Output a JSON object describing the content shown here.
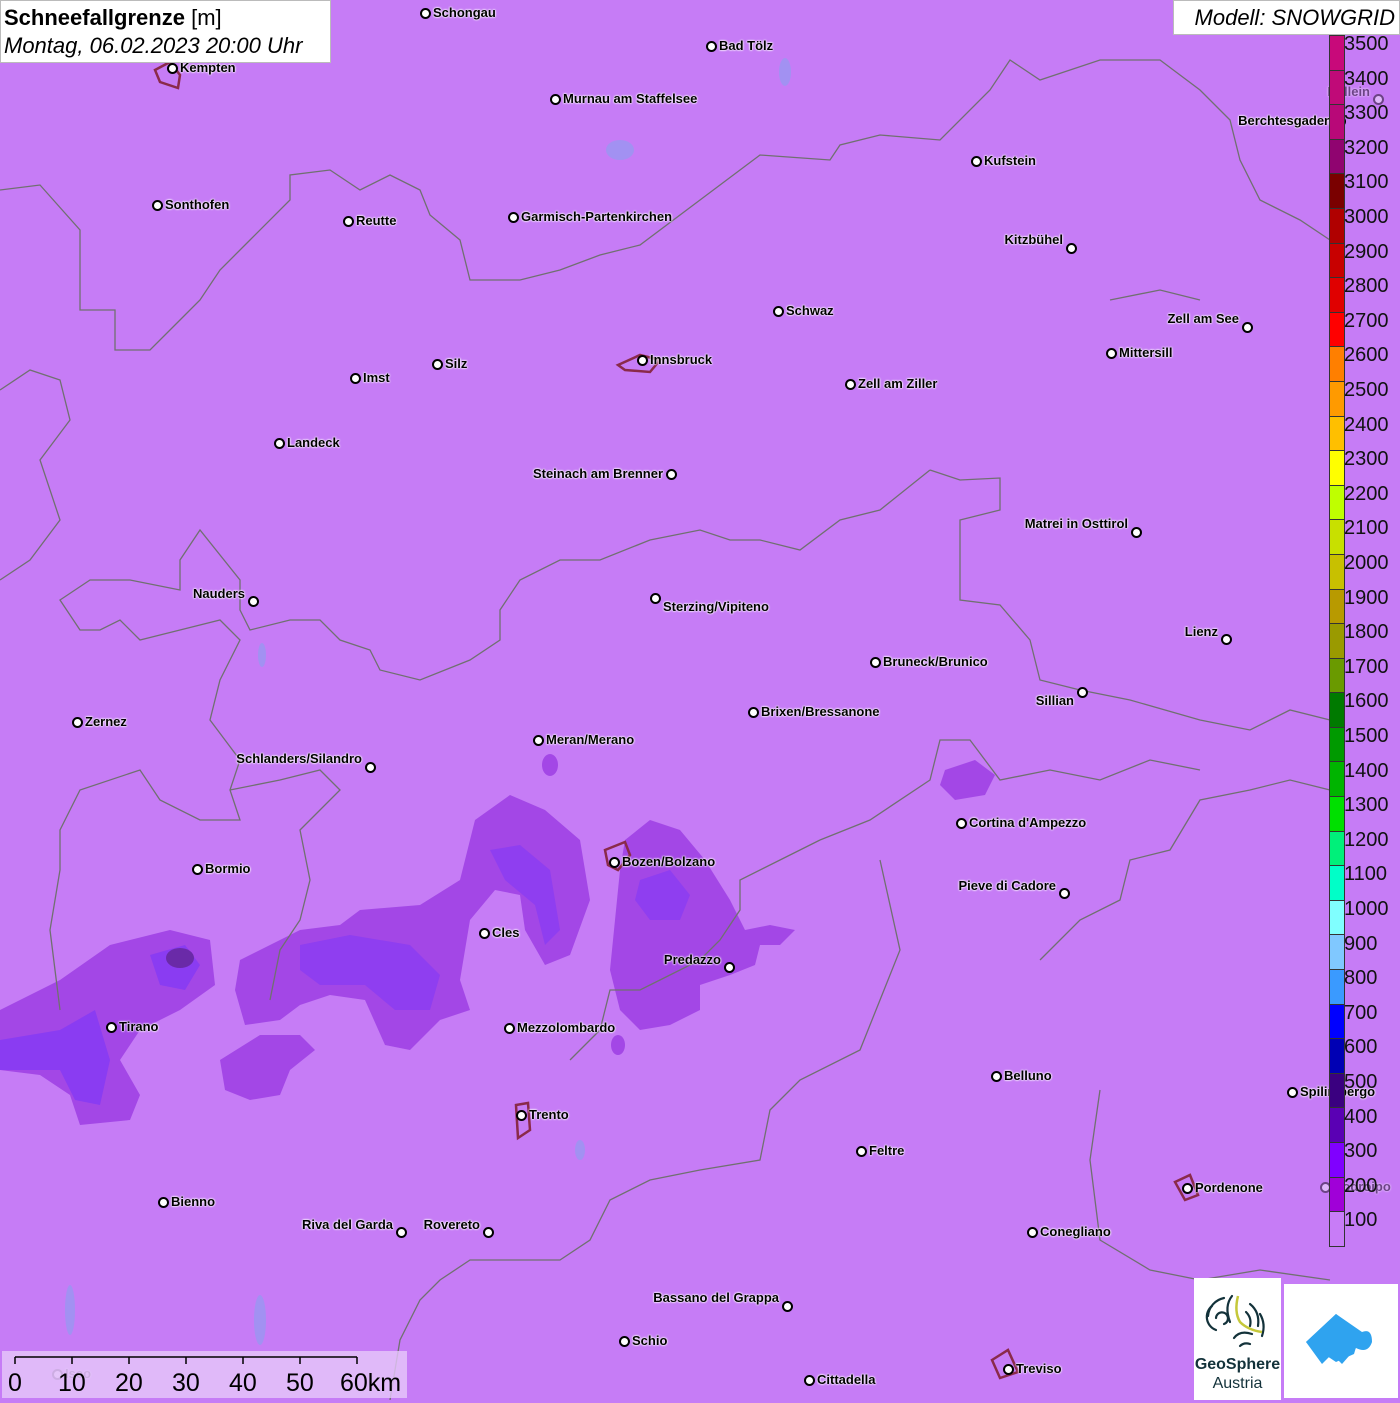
{
  "header": {
    "title_bold": "Schneefallgrenze",
    "title_unit": "[m]",
    "datetime": "Montag, 06.02.2023 20:00 Uhr",
    "model": "Modell: SNOWGRID"
  },
  "legend": {
    "labels": [
      "3500",
      "3400",
      "3300",
      "3200",
      "3100",
      "3000",
      "2900",
      "2800",
      "2700",
      "2600",
      "2500",
      "2400",
      "2300",
      "2200",
      "2100",
      "2000",
      "1900",
      "1800",
      "1700",
      "1600",
      "1500",
      "1400",
      "1300",
      "1200",
      "1100",
      "1000",
      "900",
      "800",
      "700",
      "600",
      "500",
      "400",
      "300",
      "200",
      "100"
    ],
    "colors": [
      "#c8097a",
      "#c00a78",
      "#b80878",
      "#900470",
      "#7a0000",
      "#b00000",
      "#c80000",
      "#e00000",
      "#ff0000",
      "#ff7f00",
      "#ff9a00",
      "#ffbf00",
      "#ffff00",
      "#bfff00",
      "#c8e000",
      "#c8c000",
      "#b89a00",
      "#9a9a00",
      "#6a9a00",
      "#007a00",
      "#009a00",
      "#00b400",
      "#00e000",
      "#00f07a",
      "#00ffc8",
      "#80ffff",
      "#80c8ff",
      "#3a9aff",
      "#0000ff",
      "#0000b4",
      "#3a0080",
      "#5a00b4",
      "#8000ff",
      "#a000d8",
      "#c87cf7"
    ]
  },
  "cities": [
    "Schongau",
    "Bad Tölz",
    "Kempten",
    "Murnau am Staffelsee",
    "Hallein",
    "Berchtesgaden",
    "Kufstein",
    "Sonthofen",
    "Reutte",
    "Garmisch-Partenkirchen",
    "Kitzbühel",
    "Schwaz",
    "Zell am See",
    "Innsbruck",
    "Mittersill",
    "Silz",
    "Imst",
    "Zell am Ziller",
    "Landeck",
    "Steinach am Brenner",
    "Matrei in Osttirol",
    "Nauders",
    "Sterzing/Vipiteno",
    "Lienz",
    "Bruneck/Brunico",
    "Sillian",
    "Brixen/Bressanone",
    "Zernez",
    "Meran/Merano",
    "Schlanders/Silandro",
    "Cortina d'Ampezzo",
    "Bozen/Bolzano",
    "Bormio",
    "Pieve di Cadore",
    "Cles",
    "Predazzo",
    "Tirano",
    "Mezzolombardo",
    "Belluno",
    "Spilimbergo",
    "Trento",
    "Feltre",
    "Pordenone",
    "Codroipo",
    "Bienno",
    "Riva del Garda",
    "Rovereto",
    "Conegliano",
    "Bassano del Grappa",
    "Schio",
    "Iseo",
    "Treviso",
    "Cittadella"
  ],
  "scale": {
    "labels": [
      "0",
      "10",
      "20",
      "30",
      "40",
      "50",
      "60km"
    ]
  },
  "logos": {
    "geosphere_line1": "GeoSphere",
    "geosphere_line2": "Austria"
  },
  "colors": {
    "background": "#c67cf6",
    "border": "#707070"
  }
}
